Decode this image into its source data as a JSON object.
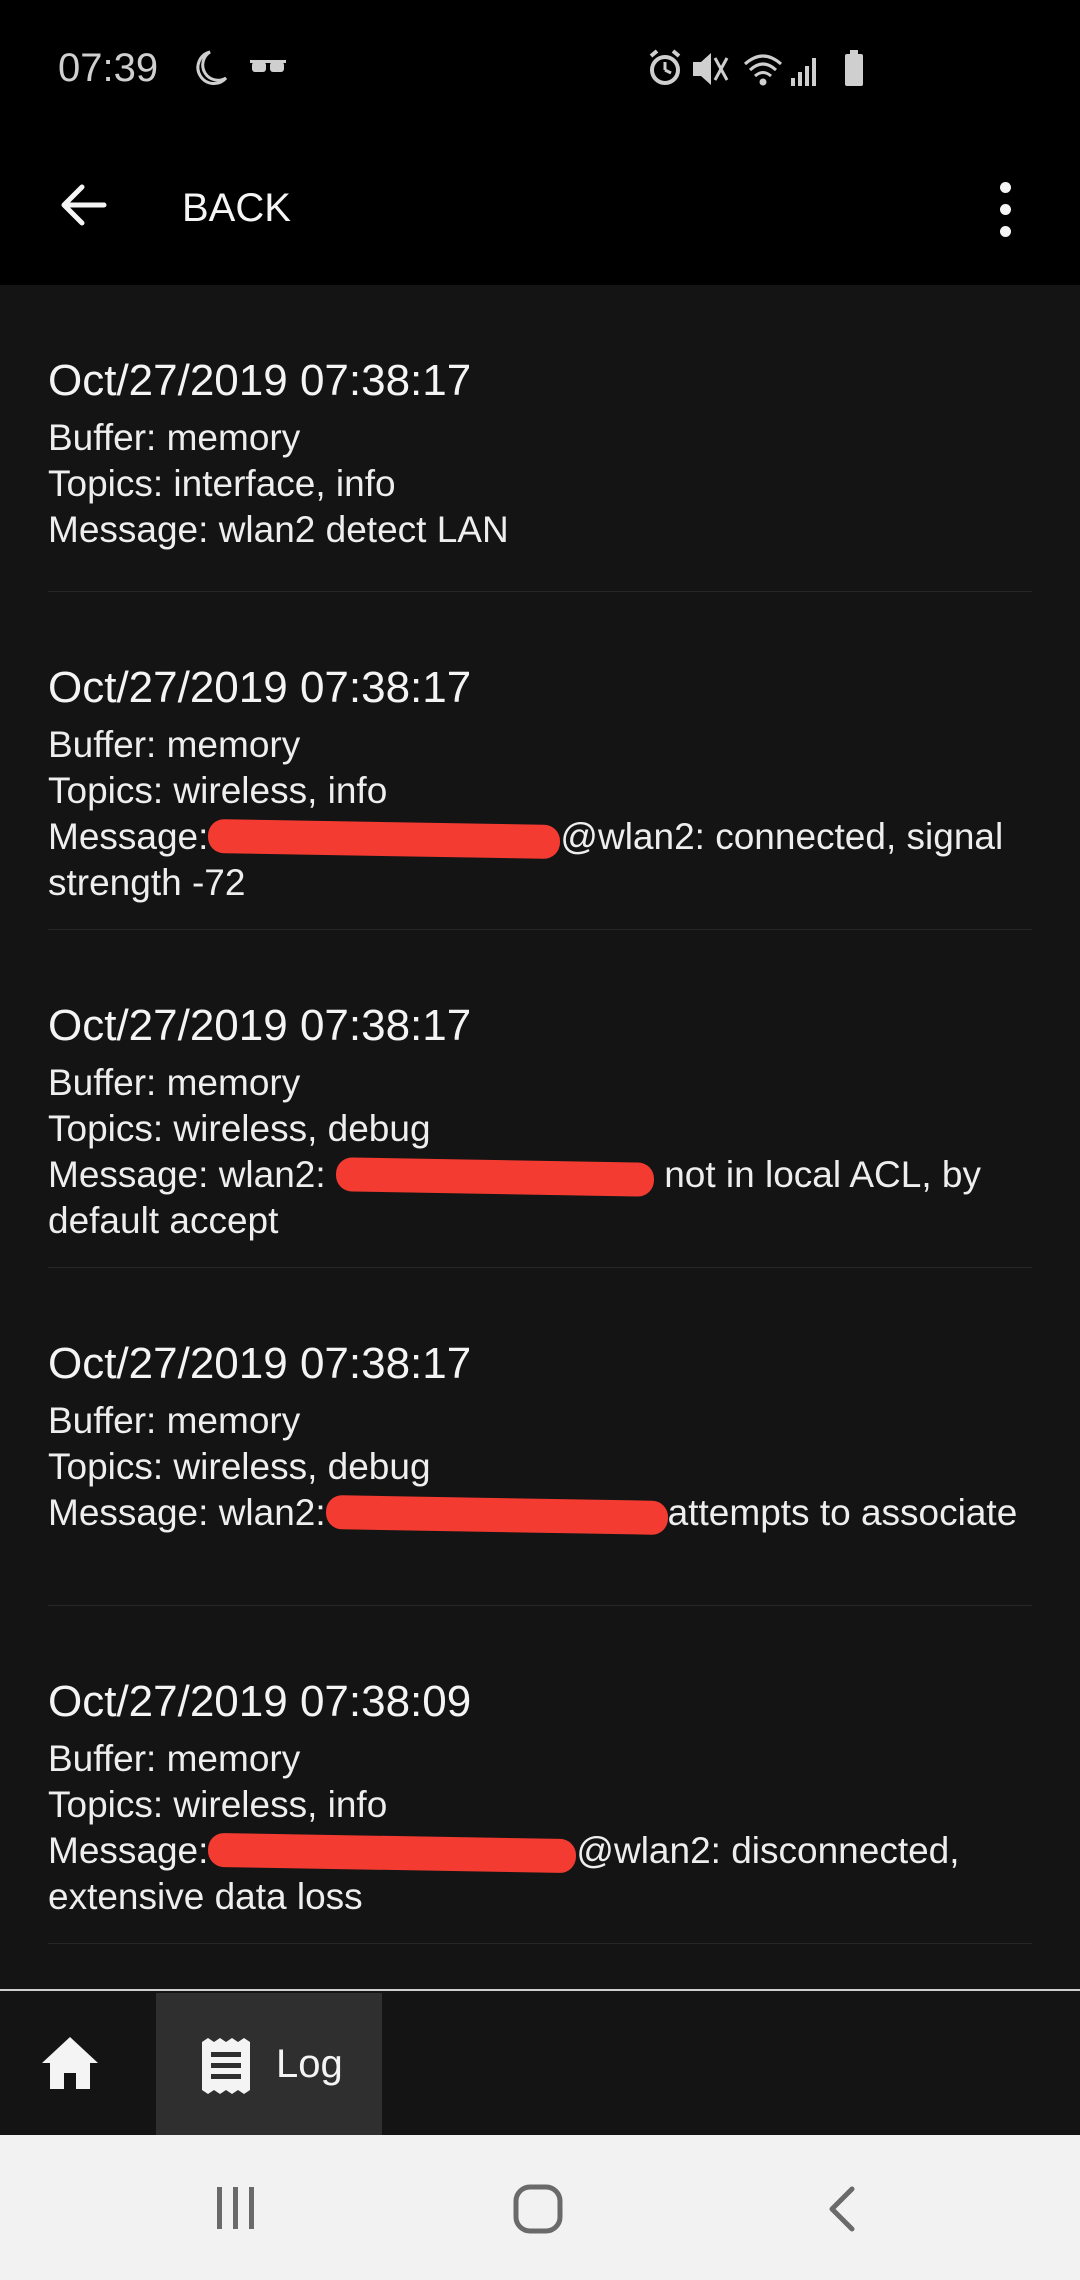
{
  "status_bar": {
    "time": "07:39",
    "left_icons": [
      "moon-icon",
      "sunglasses-icon"
    ],
    "right_icons": [
      "alarm-icon",
      "vibrate-icon",
      "wifi-icon",
      "signal-icon",
      "battery-icon"
    ]
  },
  "app_bar": {
    "back_label": "BACK",
    "back_icon": "arrow-left-icon",
    "menu_icon": "more-vert-icon"
  },
  "log_entries": [
    {
      "date": "Oct/27/2019 07:38:17",
      "buffer": "Buffer: memory",
      "topics": "Topics: interface, info",
      "message_prefix": "Message: wlan2 detect LAN",
      "message_suffix": "",
      "redacted": false
    },
    {
      "date": "Oct/27/2019 07:38:17",
      "buffer": "Buffer: memory",
      "topics": "Topics: wireless, info",
      "message_prefix": "Message:",
      "message_suffix": "@wlan2: connected, signal strength -72",
      "redacted": true
    },
    {
      "date": "Oct/27/2019 07:38:17",
      "buffer": "Buffer: memory",
      "topics": "Topics: wireless, debug",
      "message_prefix": "Message: wlan2:",
      "message_suffix": "not in local ACL, by default accept",
      "redacted": true
    },
    {
      "date": "Oct/27/2019 07:38:17",
      "buffer": "Buffer: memory",
      "topics": "Topics: wireless, debug",
      "message_prefix": "Message: wlan2:",
      "message_suffix": "attempts to associate",
      "redacted": true
    },
    {
      "date": "Oct/27/2019 07:38:09",
      "buffer": "Buffer: memory",
      "topics": "Topics: wireless, info",
      "message_prefix": "Message:",
      "message_suffix": "@wlan2: disconnected, extensive data loss",
      "redacted": true
    }
  ],
  "bottom_nav": {
    "home_icon": "home-icon",
    "log_tab_label": "Log",
    "log_tab_icon": "receipt-icon"
  },
  "system_nav": [
    "recent-apps-icon",
    "home-circle-icon",
    "back-chevron-icon"
  ],
  "colors": {
    "background": "#141414",
    "bar": "#000000",
    "redaction": "#f33b31",
    "active_tab": "#2f2f2f",
    "system_nav": "#f2f2f2"
  }
}
